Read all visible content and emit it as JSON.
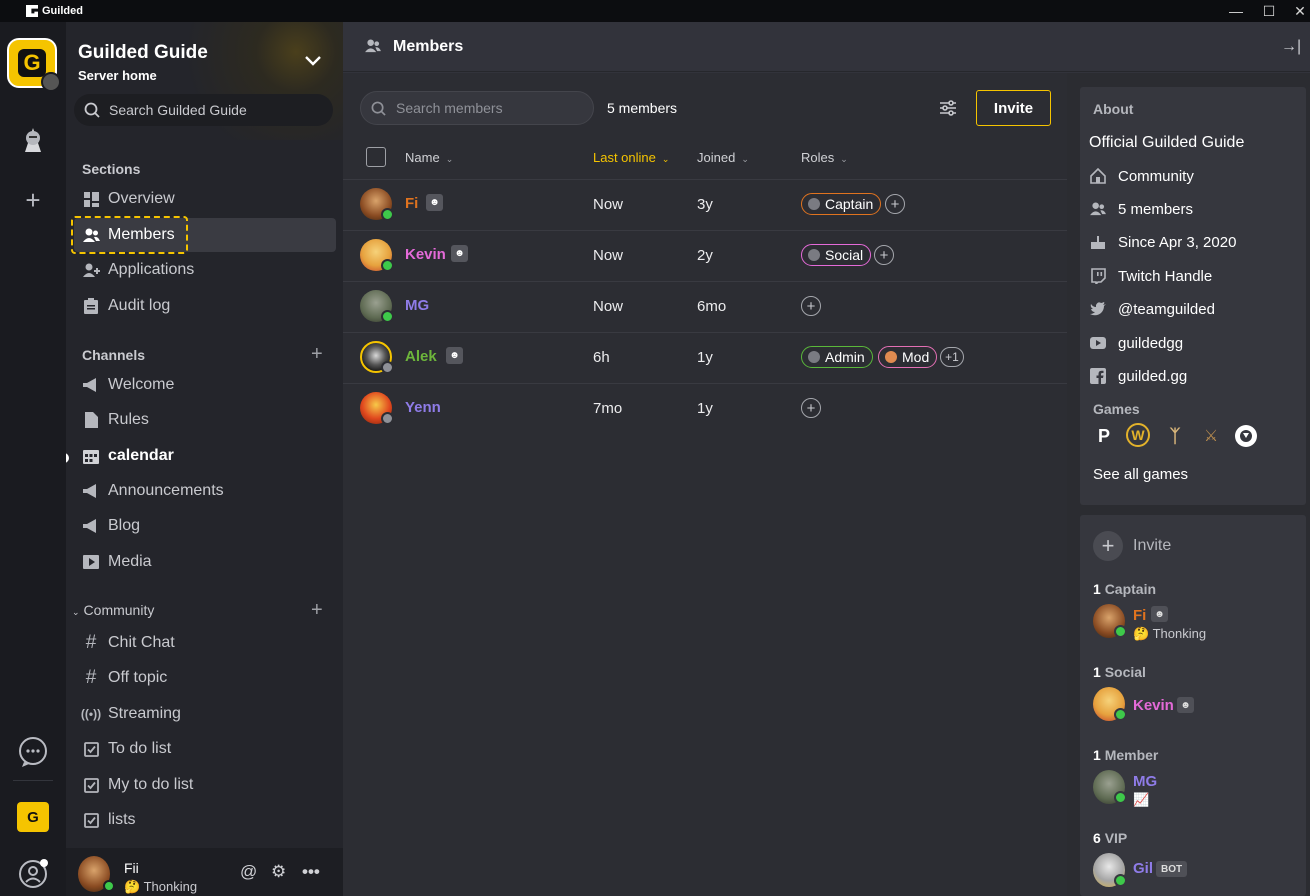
{
  "window": {
    "app_title": "Guilded",
    "minimize": "—",
    "maximize": "☐",
    "close": "✕"
  },
  "server": {
    "name": "Guilded Guide",
    "subtitle": "Server home",
    "search_placeholder": "Search Guilded Guide"
  },
  "sidebar": {
    "sections_title": "Sections",
    "sections": [
      {
        "label": "Overview",
        "icon": "grid-icon"
      },
      {
        "label": "Members",
        "icon": "members-icon",
        "active": true
      },
      {
        "label": "Applications",
        "icon": "add-user-icon"
      },
      {
        "label": "Audit log",
        "icon": "clipboard-icon"
      }
    ],
    "channels_title": "Channels",
    "channels": [
      {
        "label": "Welcome",
        "icon": "megaphone-icon"
      },
      {
        "label": "Rules",
        "icon": "document-icon"
      },
      {
        "label": "calendar",
        "icon": "calendar-icon",
        "unread": true
      },
      {
        "label": "Announcements",
        "icon": "megaphone-icon"
      },
      {
        "label": "Blog",
        "icon": "megaphone-icon"
      },
      {
        "label": "Media",
        "icon": "media-icon"
      }
    ],
    "community_title": "Community",
    "community": [
      {
        "label": "Chit Chat",
        "icon": "hash-icon"
      },
      {
        "label": "Off topic",
        "icon": "hash-icon"
      },
      {
        "label": "Streaming",
        "icon": "broadcast-icon"
      },
      {
        "label": "To do list",
        "icon": "checkbox-icon"
      },
      {
        "label": "My to do list",
        "icon": "checkbox-icon"
      },
      {
        "label": "lists",
        "icon": "checkbox-icon"
      }
    ]
  },
  "user": {
    "name": "Fii",
    "status": "🤔 Thonking"
  },
  "main": {
    "title": "Members",
    "search_placeholder": "Search members",
    "count": "5 members",
    "invite_label": "Invite",
    "columns": {
      "name": "Name",
      "last_online": "Last online",
      "joined": "Joined",
      "roles": "Roles"
    },
    "rows": [
      {
        "name": "Fi",
        "color": "#e0731f",
        "last_online": "Now",
        "joined": "3y",
        "online": true,
        "roles": [
          {
            "label": "Captain",
            "color": "#e0731f"
          }
        ],
        "extra": ""
      },
      {
        "name": "Kevin",
        "color": "#e46ad8",
        "last_online": "Now",
        "joined": "2y",
        "online": true,
        "roles": [
          {
            "label": "Social",
            "color": "#e46ad8"
          }
        ],
        "extra": ""
      },
      {
        "name": "MG",
        "color": "#8f7ce8",
        "last_online": "Now",
        "joined": "6mo",
        "online": true,
        "roles": [],
        "extra": ""
      },
      {
        "name": "Alek",
        "color": "#6db63b",
        "last_online": "6h",
        "joined": "1y",
        "online": false,
        "roles": [
          {
            "label": "Admin",
            "color": "#5ab83a"
          },
          {
            "label": "Mod",
            "color": "#e36fb4"
          }
        ],
        "extra": "+1"
      },
      {
        "name": "Yenn",
        "color": "#8f7ce8",
        "last_online": "7mo",
        "joined": "1y",
        "online": false,
        "roles": [],
        "extra": ""
      }
    ]
  },
  "about": {
    "title": "About",
    "name": "Official Guilded Guide",
    "items": [
      {
        "label": "Community",
        "icon": "community-icon"
      },
      {
        "label": "5 members",
        "icon": "members-icon"
      },
      {
        "label": "Since Apr 3, 2020",
        "icon": "cake-icon"
      },
      {
        "label": "Twitch Handle",
        "icon": "twitch-icon"
      },
      {
        "label": "@teamguilded",
        "icon": "twitter-icon"
      },
      {
        "label": "guildedgg",
        "icon": "youtube-icon"
      },
      {
        "label": "guilded.gg",
        "icon": "facebook-icon"
      }
    ],
    "games_title": "Games",
    "see_all": "See all games"
  },
  "roster": {
    "invite_label": "Invite",
    "groups": [
      {
        "count": "1",
        "name": "Captain"
      },
      {
        "count": "1",
        "name": "Social"
      },
      {
        "count": "1",
        "name": "Member"
      },
      {
        "count": "6",
        "name": "VIP"
      }
    ],
    "members": [
      {
        "name": "Fi",
        "status": "🤔 Thonking",
        "color": "#e0731f"
      },
      {
        "name": "Kevin",
        "status": "",
        "color": "#e46ad8"
      },
      {
        "name": "MG",
        "status": "📈",
        "color": "#8f7ce8"
      },
      {
        "name": "Gil",
        "status": "",
        "color": "#8f7ce8",
        "tag": "BOT"
      }
    ]
  }
}
